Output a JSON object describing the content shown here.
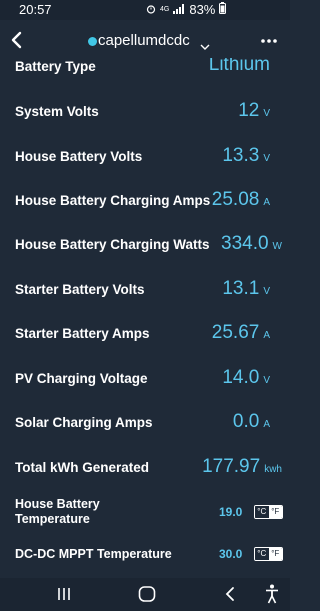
{
  "status_bar": {
    "time": "20:57",
    "network": "4G",
    "battery_percent": "83%"
  },
  "header": {
    "device_name": "capellumdcdc",
    "accent_color": "#41c7e6"
  },
  "rows": [
    {
      "label": "Battery Type",
      "value": "Lithium",
      "unit": ""
    },
    {
      "label": "System Volts",
      "value": "12",
      "unit": "V"
    },
    {
      "label": "House Battery Volts",
      "value": "13.3",
      "unit": "V"
    },
    {
      "label": "House Battery Charging Amps",
      "value": "25.08",
      "unit": "A"
    },
    {
      "label": "House Battery Charging Watts",
      "value": "334.0",
      "unit": "W"
    },
    {
      "label": "Starter Battery Volts",
      "value": "13.1",
      "unit": "V"
    },
    {
      "label": "Starter Battery Amps",
      "value": "25.67",
      "unit": "A"
    },
    {
      "label": "PV Charging Voltage",
      "value": "14.0",
      "unit": "V"
    },
    {
      "label": "Solar Charging Amps",
      "value": "0.0",
      "unit": "A"
    },
    {
      "label": "Total kWh Generated",
      "value": "177.97",
      "unit": "kwh"
    }
  ],
  "temperature_rows": [
    {
      "label_line1": "House Battery",
      "label_line2": "Temperature",
      "value": "19.0",
      "option_c": "°C",
      "option_f": "°F"
    },
    {
      "label": "DC-DC MPPT Temperature",
      "value": "30.0",
      "option_c": "°C",
      "option_f": "°F"
    }
  ],
  "colors": {
    "background": "#1f2a38",
    "value_text": "#5cc6ec"
  }
}
